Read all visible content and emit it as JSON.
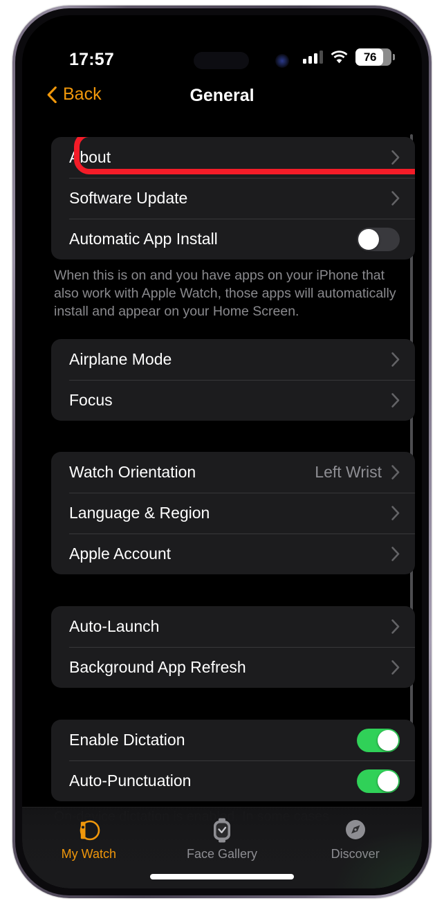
{
  "status_bar": {
    "time": "17:57",
    "cellular_icon": "cellular-signal-icon",
    "wifi_icon": "wifi-icon",
    "battery_percent": "76",
    "battery_level": 76
  },
  "nav": {
    "back_label": "Back",
    "title": "General",
    "accent_color": "#f0970b"
  },
  "highlight": {
    "color": "#f41c28",
    "target": "About"
  },
  "groups": [
    {
      "id": "group-general-top",
      "rows": [
        {
          "label": "About",
          "type": "disclosure",
          "highlighted": true
        },
        {
          "label": "Software Update",
          "type": "disclosure"
        },
        {
          "label": "Automatic App Install",
          "type": "toggle",
          "toggle_state": "off"
        }
      ],
      "footnote": "When this is on and you have apps on your iPhone that also work with Apple Watch, those apps will automatically install and appear on your Home Screen."
    },
    {
      "id": "group-connectivity",
      "rows": [
        {
          "label": "Airplane Mode",
          "type": "disclosure"
        },
        {
          "label": "Focus",
          "type": "disclosure"
        }
      ],
      "footnote": ""
    },
    {
      "id": "group-device",
      "rows": [
        {
          "label": "Watch Orientation",
          "type": "disclosure",
          "value": "Left Wrist"
        },
        {
          "label": "Language & Region",
          "type": "disclosure"
        },
        {
          "label": "Apple Account",
          "type": "disclosure"
        }
      ],
      "footnote": ""
    },
    {
      "id": "group-apps",
      "rows": [
        {
          "label": "Auto-Launch",
          "type": "disclosure"
        },
        {
          "label": "Background App Refresh",
          "type": "disclosure"
        }
      ],
      "footnote": ""
    },
    {
      "id": "group-dictation",
      "rows": [
        {
          "label": "Enable Dictation",
          "type": "toggle",
          "toggle_state": "on"
        },
        {
          "label": "Auto-Punctuation",
          "type": "toggle",
          "toggle_state": "on"
        }
      ],
      "footnote": "On-device dictation is enabled. In some cases"
    }
  ],
  "tab_bar": {
    "tabs": [
      {
        "label": "My Watch",
        "icon": "watch-side-icon",
        "active": true
      },
      {
        "label": "Face Gallery",
        "icon": "watch-face-icon",
        "active": false
      },
      {
        "label": "Discover",
        "icon": "compass-icon",
        "active": false
      }
    ]
  },
  "colors": {
    "accent": "#f0970b",
    "toggle_on": "#30d158",
    "toggle_off": "#39393d",
    "row_background": "#1c1c1e",
    "screen_background": "#000000",
    "secondary_text": "#8e8e93"
  }
}
